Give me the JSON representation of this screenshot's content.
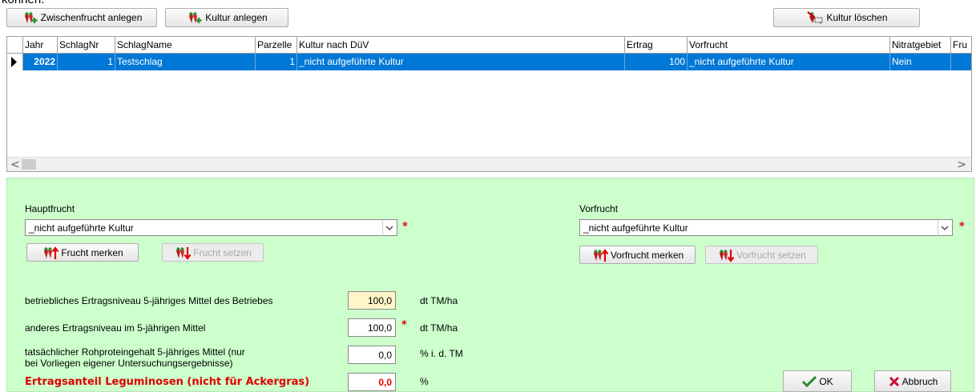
{
  "top_cutoff_text": "können.",
  "toolbar": {
    "zwischenfrucht_label": "Zwischenfrucht anlegen",
    "kultur_anlegen_label": "Kultur anlegen",
    "kultur_loeschen_label": "Kultur löschen"
  },
  "grid": {
    "columns": [
      "Jahr",
      "SchlagNr",
      "SchlagName",
      "Parzelle",
      "Kultur nach DüV",
      "Ertrag",
      "Vorfrucht",
      "Nitratgebiet",
      "Fru"
    ],
    "rows": [
      {
        "jahr": "2022",
        "schlagnr": "1",
        "schlagname": "Testschlag",
        "parzelle": "1",
        "kultur": "_nicht aufgeführte Kultur",
        "ertrag": "100",
        "vorfrucht": "_nicht aufgeführte Kultur",
        "nitratgebiet": "Nein",
        "fru": ""
      }
    ],
    "scroll_left": "<",
    "scroll_right": ">"
  },
  "form": {
    "hauptfrucht_label": "Hauptfrucht",
    "hauptfrucht_value": "_nicht aufgeführte Kultur",
    "vorfrucht_label": "Vorfrucht",
    "vorfrucht_value": "_nicht aufgeführte Kultur",
    "required_mark": "*",
    "frucht_merken": "Frucht merken",
    "frucht_setzen": "Frucht setzen",
    "vorfrucht_merken": "Vorfrucht merken",
    "vorfrucht_setzen": "Vorfrucht setzen",
    "betrieb_label": "betriebliches Ertragsniveau 5-jähriges Mittel des Betriebes",
    "betrieb_value": "100,0",
    "betrieb_unit": "dt TM/ha",
    "anderes_label": "anderes Ertragsniveau im 5-jährigen Mittel",
    "anderes_value": "100,0",
    "anderes_unit": "dt TM/ha",
    "rohprotein_label_1": "tatsächlicher Rohproteingehalt 5-jähriges Mittel   (nur",
    "rohprotein_label_2": "bei Vorliegen eigener Untersuchungsergebnisse)",
    "rohprotein_value": "0,0",
    "rohprotein_unit": "% i. d. TM",
    "leguminosen_label": "Ertragsanteil Leguminosen (nicht für Ackergras)",
    "leguminosen_value": "0,0",
    "leguminosen_unit": "%",
    "ok_label": "OK",
    "abbruch_label": "Abbruch"
  },
  "colors": {
    "selection": "#0078d7",
    "form_bg": "#ccffcc",
    "required": "#e00000",
    "highlight_field": "#fff5c8"
  }
}
